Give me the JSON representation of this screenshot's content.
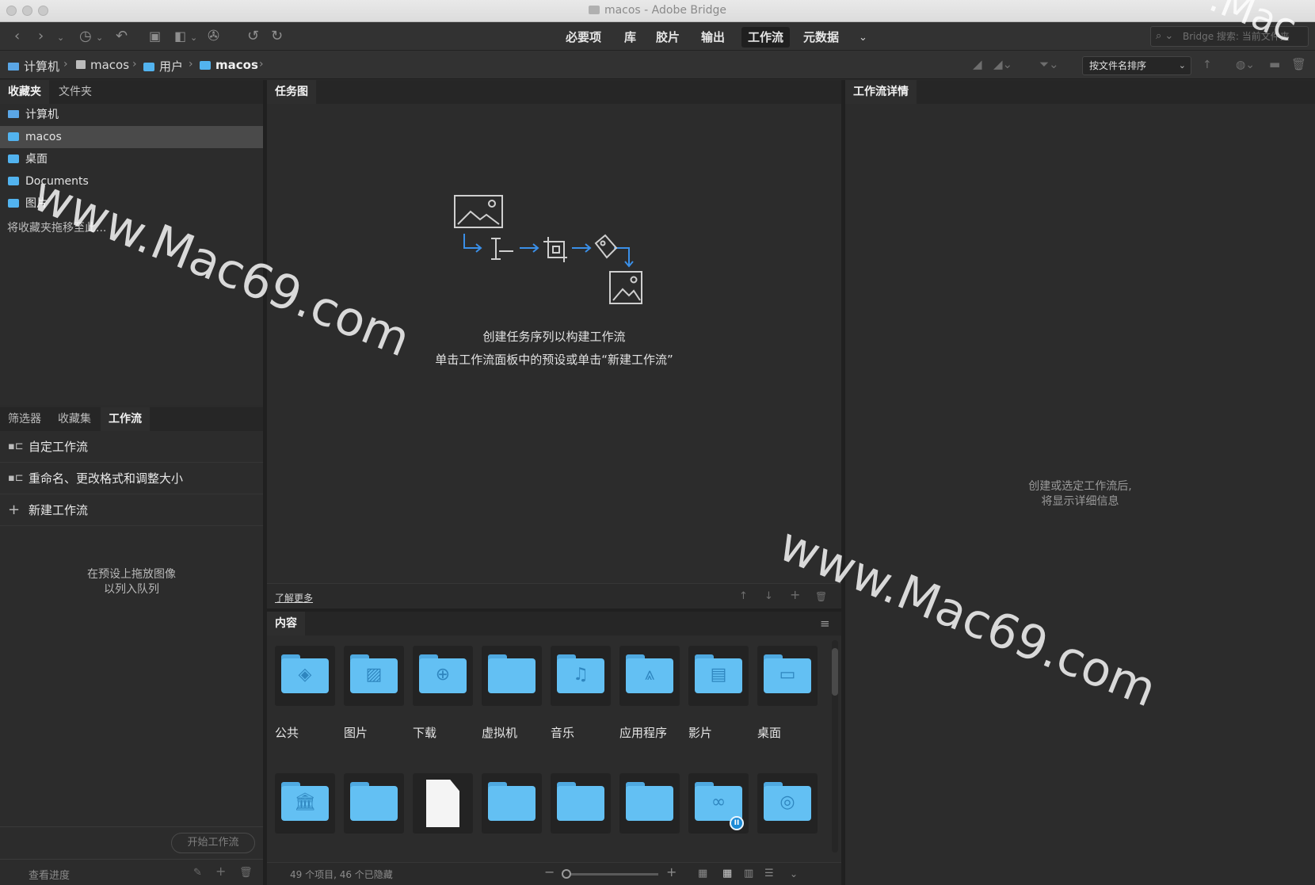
{
  "window": {
    "title": "macos - Adobe Bridge"
  },
  "workspaces": [
    {
      "label": "必要项"
    },
    {
      "label": "库"
    },
    {
      "label": "胶片"
    },
    {
      "label": "输出"
    },
    {
      "label": "工作流",
      "active": true
    },
    {
      "label": "元数据"
    }
  ],
  "search": {
    "placeholder": "Bridge 搜索: 当前文件夹"
  },
  "breadcrumb": [
    {
      "label": "计算机",
      "icon": "computer-icon"
    },
    {
      "label": "macos",
      "icon": "disk-icon"
    },
    {
      "label": "用户",
      "icon": "folder-icon"
    },
    {
      "label": "macos",
      "icon": "folder-icon"
    }
  ],
  "sort": {
    "label": "按文件名排序"
  },
  "favorites_panel": {
    "tabs": [
      "收藏夹",
      "文件夹"
    ],
    "items": [
      {
        "label": "计算机",
        "icon": "computer-icon"
      },
      {
        "label": "macos",
        "icon": "folder-icon",
        "selected": true
      },
      {
        "label": "桌面",
        "icon": "folder-icon"
      },
      {
        "label": "Documents",
        "icon": "folder-icon"
      },
      {
        "label": "图片",
        "icon": "folder-icon"
      }
    ],
    "drop_hint": "将收藏夹拖移至此..."
  },
  "workflow_panel": {
    "tabs": [
      "筛选器",
      "收藏集",
      "工作流"
    ],
    "items": [
      {
        "label": "自定工作流"
      },
      {
        "label": "重命名、更改格式和调整大小"
      },
      {
        "label": "新建工作流"
      }
    ],
    "hint_line1": "在预设上拖放图像",
    "hint_line2": "以列入队列",
    "start_button": "开始工作流",
    "progress_label": "查看进度"
  },
  "task_map": {
    "tab": "任务图",
    "line1": "创建任务序列以构建工作流",
    "line2": "单击工作流面板中的预设或单击“新建工作流”",
    "learn_more": "了解更多"
  },
  "details_panel": {
    "tab": "工作流详情",
    "hint_line1": "创建或选定工作流后,",
    "hint_line2": "将显示详细信息"
  },
  "content_panel": {
    "tab": "内容",
    "row1": [
      {
        "label": "公共",
        "icon": "public-folder-icon"
      },
      {
        "label": "图片",
        "icon": "pictures-folder-icon"
      },
      {
        "label": "下载",
        "icon": "downloads-folder-icon"
      },
      {
        "label": "虚拟机",
        "icon": "folder-icon"
      },
      {
        "label": "音乐",
        "icon": "music-folder-icon"
      },
      {
        "label": "应用程序",
        "icon": "applications-folder-icon"
      },
      {
        "label": "影片",
        "icon": "movies-folder-icon"
      },
      {
        "label": "桌面",
        "icon": "desktop-folder-icon"
      }
    ],
    "row2_icons": [
      "library-folder-icon",
      "folder-icon",
      "document-icon",
      "folder-icon",
      "folder-icon",
      "folder-icon",
      "creative-cloud-folder-icon",
      "sites-folder-icon"
    ],
    "status": "49 个项目, 46 个已隐藏"
  },
  "watermarks": [
    "www.Mac69.com",
    "www.Mac69.com",
    ".Mac"
  ],
  "colors": {
    "folder": "#63c0f3",
    "accent": "#1c8bd6",
    "bg": "#2c2c2c"
  }
}
